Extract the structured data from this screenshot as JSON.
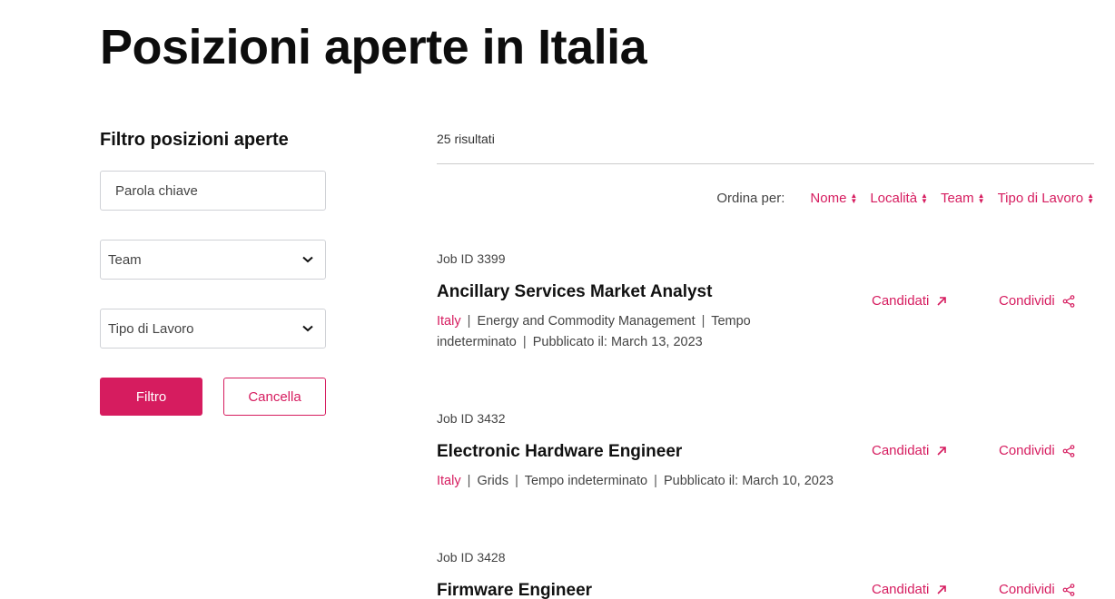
{
  "page": {
    "title": "Posizioni aperte in Italia"
  },
  "colors": {
    "accent": "#d61c5f",
    "text": "#111111",
    "muted": "#444444",
    "border": "#cfd1d6"
  },
  "filters": {
    "heading": "Filtro posizioni aperte",
    "keyword_placeholder": "Parola chiave",
    "team_label": "Team",
    "work_type_label": "Tipo di Lavoro",
    "filter_button": "Filtro",
    "clear_button": "Cancella"
  },
  "results": {
    "count": "25 risultati",
    "sort_label": "Ordina per:",
    "sort_options": [
      "Nome",
      "Località",
      "Team",
      "Tipo di Lavoro"
    ],
    "apply_label": "Candidati",
    "share_label": "Condividi",
    "jobs": [
      {
        "id": "Job ID 3399",
        "title": "Ancillary Services Market Analyst",
        "location": "Italy",
        "team": "Energy and Commodity Management",
        "type": "Tempo indeterminato",
        "published": "Pubblicato il: March 13, 2023"
      },
      {
        "id": "Job ID 3432",
        "title": "Electronic Hardware Engineer",
        "location": "Italy",
        "team": "Grids",
        "type": "Tempo indeterminato",
        "published": "Pubblicato il: March 10, 2023"
      },
      {
        "id": "Job ID 3428",
        "title": "Firmware Engineer"
      }
    ]
  },
  "icons": {
    "chevron": "chevron-down-icon",
    "sort": "sort-arrows-icon",
    "external": "arrow-up-right-icon",
    "share": "share-icon"
  }
}
